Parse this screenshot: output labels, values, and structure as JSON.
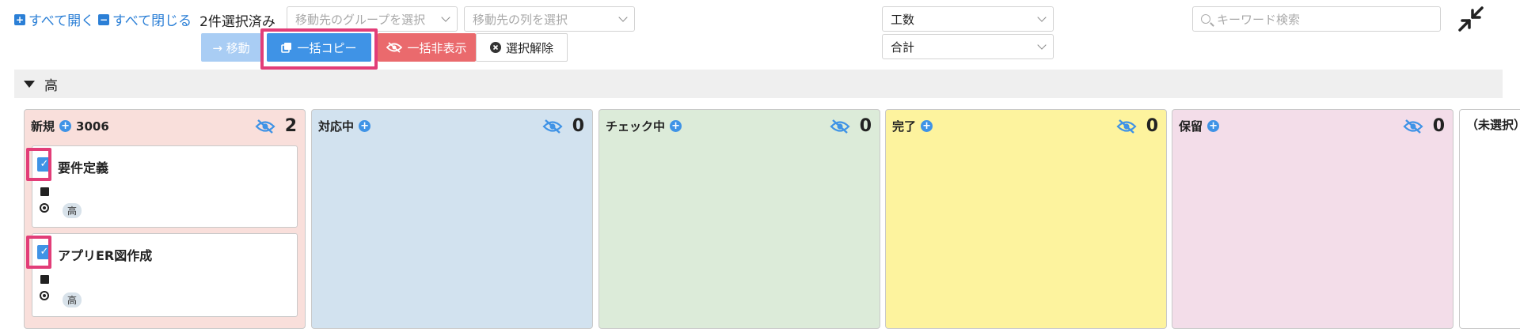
{
  "toolbar": {
    "expand_all": "すべて開く",
    "collapse_all": "すべて閉じる",
    "selected_count": "2件選択済み",
    "move_group_placeholder": "移動先のグループを選択",
    "move_column_placeholder": "移動先の列を選択",
    "metric_select": "工数",
    "aggregate_select": "合計",
    "search_placeholder": "キーワード検索"
  },
  "actions": {
    "move": "→ 移動",
    "bulk_copy": "一括コピー",
    "bulk_hide": "一括非表示",
    "clear_selection": "選択解除"
  },
  "group": {
    "label": "高"
  },
  "columns": [
    {
      "name": "新規",
      "extra": "3006",
      "count": "2",
      "color": "#f9dfdb"
    },
    {
      "name": "対応中",
      "extra": "",
      "count": "0",
      "color": "#d2e2ef"
    },
    {
      "name": "チェック中",
      "extra": "",
      "count": "0",
      "color": "#dcebd9"
    },
    {
      "name": "完了",
      "extra": "",
      "count": "0",
      "color": "#fdf39e"
    },
    {
      "name": "保留",
      "extra": "",
      "count": "0",
      "color": "#f3dde9"
    },
    {
      "name": "（未選択）",
      "extra": "",
      "count": "",
      "color": "#ffffff"
    }
  ],
  "cards": [
    {
      "title": "要件定義",
      "priority": "高",
      "checked": true
    },
    {
      "title": "アプリER図作成",
      "priority": "高",
      "checked": true
    }
  ],
  "colors": {
    "accent": "#3f93e6",
    "danger": "#ea6a6d",
    "highlight": "#e23d78"
  }
}
